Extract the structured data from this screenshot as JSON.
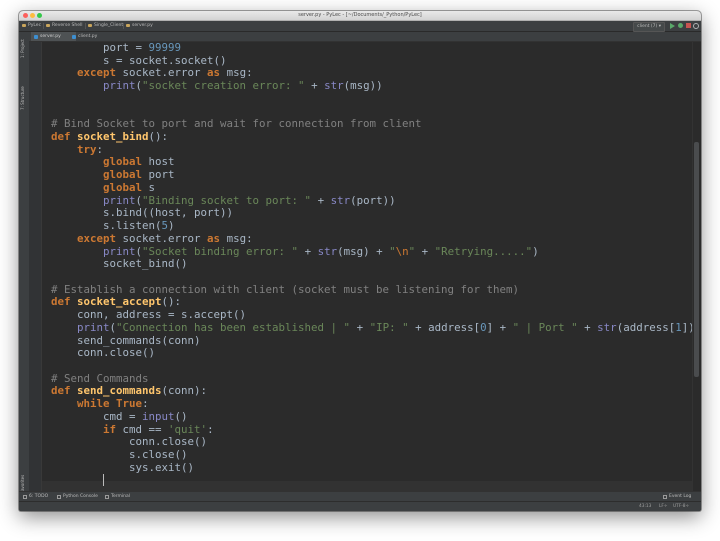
{
  "window": {
    "title": "server.py - PyLec - [~/Documents/_Python/PyLec]"
  },
  "navbar": {
    "crumbs": [
      "PyLec",
      "Reverse Shell",
      "Single_Client",
      "server.py"
    ],
    "run_config": "client (7) ▾"
  },
  "tabs": [
    {
      "label": "server.py"
    },
    {
      "label": "client.py"
    }
  ],
  "left_tools": {
    "project": "1: Project",
    "structure": "7: Structure",
    "favorites": "2: Favorites"
  },
  "code_lines": [
    "        port = 99999",
    "        s = socket.socket()",
    "    except socket.error as msg:",
    "        print(\"socket creation error: \" + str(msg))",
    "",
    "",
    "# Bind Socket to port and wait for connection from client",
    "def socket_bind():",
    "    try:",
    "        global host",
    "        global port",
    "        global s",
    "        print(\"Binding socket to port: \" + str(port))",
    "        s.bind((host, port))",
    "        s.listen(5)",
    "    except socket.error as msg:",
    "        print(\"Socket binding error: \" + str(msg) + \"\\n\" + \"Retrying.....\")",
    "        socket_bind()",
    "",
    "# Establish a connection with client (socket must be listening for them)",
    "def socket_accept():",
    "    conn, address = s.accept()",
    "    print(\"Connection has been established | \" + \"IP: \" + address[0] + \" | Port \" + str(address[1]))",
    "    send_commands(conn)",
    "    conn.close()",
    "",
    "# Send Commands",
    "def send_commands(conn):",
    "    while True:",
    "        cmd = input()",
    "        if cmd == 'quit':",
    "            conn.close()",
    "            s.close()",
    "            sys.exit()",
    "        "
  ],
  "bottom_tools": {
    "todo": "6: TODO",
    "python_console": "Python Console",
    "terminal": "Terminal",
    "event_log": "Event Log"
  },
  "status": {
    "position": "43:13",
    "line_sep": "LF÷",
    "encoding": "UTF-8÷"
  },
  "colors": {
    "keyword": "#cc7832",
    "string": "#6a8759",
    "comment": "#808080",
    "function": "#ffc66d",
    "number": "#6897bb",
    "builtin": "#8888c6",
    "default": "#a9b7c6"
  }
}
